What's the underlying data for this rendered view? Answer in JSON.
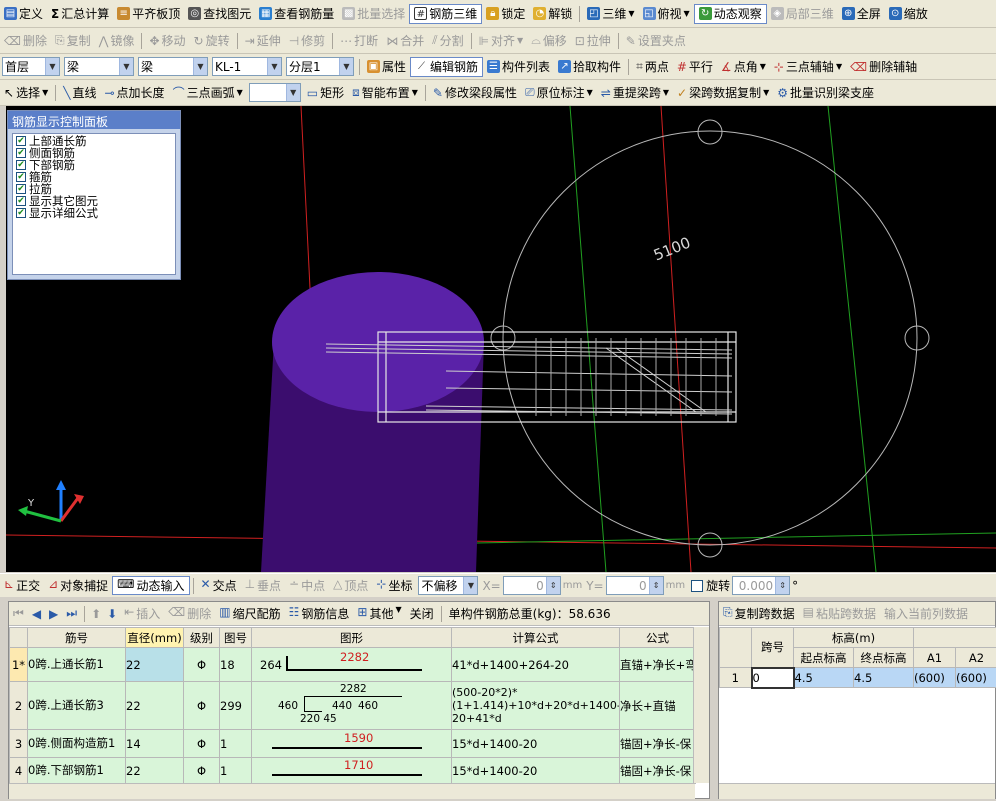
{
  "toolbar1": {
    "items": [
      "定义",
      "汇总计算",
      "平齐板顶",
      "查找图元",
      "查看钢筋量",
      "批量选择",
      "钢筋三维",
      "锁定",
      "解锁",
      "三维",
      "俯视",
      "动态观察",
      "局部三维",
      "全屏",
      "缩放"
    ],
    "define": "定义",
    "sum": "汇总计算",
    "flush": "平齐板顶",
    "find": "查找图元",
    "view_rebar": "查看钢筋量",
    "batch": "批量选择",
    "rebar3d": "钢筋三维",
    "lock": "锁定",
    "unlock": "解锁",
    "three_d": "三维",
    "top_view": "俯视",
    "dynamic": "动态观察",
    "local3d": "局部三维",
    "fullscreen": "全屏",
    "zoom": "缩放"
  },
  "toolbar2": {
    "delete": "删除",
    "copy": "复制",
    "mirror": "镜像",
    "move": "移动",
    "rotate": "旋转",
    "extend": "延伸",
    "trim": "修剪",
    "break": "打断",
    "merge": "合并",
    "split": "分割",
    "align": "对齐",
    "offset": "偏移",
    "stretch": "拉伸",
    "set_point": "设置夹点"
  },
  "toolbar3": {
    "floor": "首层",
    "type1": "梁",
    "type2": "梁",
    "member": "KL-1",
    "layer": "分层1",
    "attr": "属性",
    "edit_rebar": "编辑钢筋",
    "list": "构件列表",
    "pick": "拾取构件",
    "two_point": "两点",
    "parallel": "平行",
    "point_angle": "点角",
    "three_point_axis": "三点辅轴",
    "delete_axis": "删除辅轴"
  },
  "toolbar4": {
    "select": "选择",
    "line": "直线",
    "point_len": "点加长度",
    "arc": "三点画弧",
    "rect": "矩形",
    "smart": "智能布置",
    "modify_span": "修改梁段属性",
    "origin_mark": "原位标注",
    "re_span": "重提梁跨",
    "span_copy": "梁跨数据复制",
    "batch_support": "批量识别梁支座"
  },
  "control_panel": {
    "title": "钢筋显示控制面板",
    "options": [
      "上部通长筋",
      "侧面钢筋",
      "下部钢筋",
      "箍筋",
      "拉筋",
      "显示其它图元",
      "显示详细公式"
    ]
  },
  "viewport": {
    "dimension_label": "5100",
    "axis_y": "Y"
  },
  "status_bar": {
    "ortho": "正交",
    "snap": "对象捕捉",
    "dyn_input": "动态输入",
    "intersect": "交点",
    "perp": "垂点",
    "mid": "中点",
    "vertex": "顶点",
    "coord": "坐标",
    "offset_mode": "不偏移",
    "x_label": "X=",
    "x_val": "0",
    "y_label": "Y=",
    "y_val": "0",
    "unit": "mm",
    "rotate": "旋转",
    "rotate_val": "0.000",
    "deg": "°"
  },
  "rebar_grid": {
    "toolbar": {
      "insert": "插入",
      "delete": "删除",
      "scale": "缩尺配筋",
      "info": "钢筋信息",
      "other": "其他",
      "close": "关闭",
      "total": "单构件钢筋总重(kg)：58.636"
    },
    "headers": [
      "筋号",
      "直径(mm)",
      "级别",
      "图号",
      "图形",
      "计算公式",
      "公式"
    ],
    "rows": [
      {
        "num": "1*",
        "name": "0跨.上通长筋1",
        "dia": "22",
        "grade": "Φ",
        "fig": "18",
        "shape_left": "264",
        "shape_top": "2282",
        "formula": "41*d+1400+264-20",
        "desc": "直锚+净长+弯"
      },
      {
        "num": "2",
        "name": "0跨.上通长筋3",
        "dia": "22",
        "grade": "Φ",
        "fig": "299",
        "shape_left": "460",
        "shape_top": "2282",
        "shape_mid": "440",
        "shape_right": "460",
        "shape_bottom": "220 45",
        "formula": "(500-20*2)*(1+1.414)+10*d+20*d+1400-20+41*d",
        "desc": "净长+直锚"
      },
      {
        "num": "3",
        "name": "0跨.侧面构造筋1",
        "dia": "14",
        "grade": "Φ",
        "fig": "1",
        "shape_top": "1590",
        "formula": "15*d+1400-20",
        "desc": "锚固+净长-保"
      },
      {
        "num": "4",
        "name": "0跨.下部钢筋1",
        "dia": "22",
        "grade": "Φ",
        "fig": "1",
        "shape_top": "1710",
        "formula": "15*d+1400-20",
        "desc": "锚固+净长-保"
      }
    ]
  },
  "span_grid": {
    "toolbar": {
      "copy": "复制跨数据",
      "paste": "粘贴跨数据",
      "input": "输入当前列数据"
    },
    "headers": {
      "span": "跨号",
      "elev": "标高(m)",
      "start": "起点标高",
      "end": "终点标高",
      "a1": "A1",
      "a2": "A2"
    },
    "rows": [
      {
        "idx": "1",
        "span": "0",
        "start": "4.5",
        "end": "4.5",
        "a1": "(600)",
        "a2": "(600)"
      }
    ]
  }
}
